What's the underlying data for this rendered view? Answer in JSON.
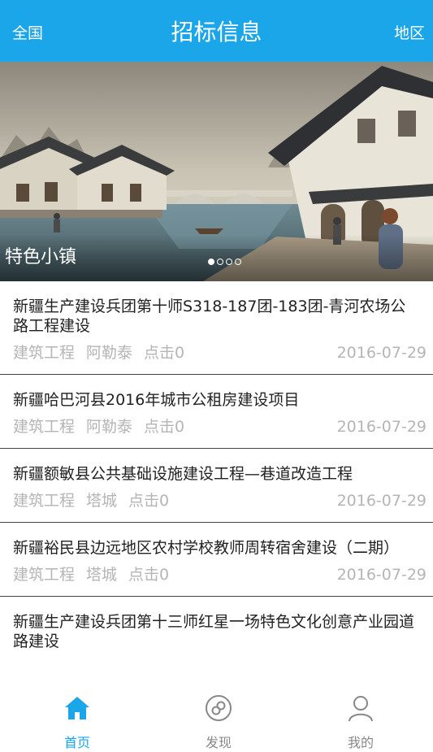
{
  "header": {
    "left": "全国",
    "title": "招标信息",
    "right": "地区"
  },
  "banner": {
    "caption": "特色小镇",
    "dots": 4,
    "active_dot": 0
  },
  "list": [
    {
      "title": "新疆生产建设兵团第十师S318-187团-183团-青河农场公路工程建设",
      "category": "建筑工程",
      "area": "阿勒泰",
      "clicks": "点击0",
      "date": "2016-07-29"
    },
    {
      "title": "新疆哈巴河县2016年城市公租房建设项目",
      "category": "建筑工程",
      "area": "阿勒泰",
      "clicks": "点击0",
      "date": "2016-07-29"
    },
    {
      "title": "新疆额敏县公共基础设施建设工程—巷道改造工程",
      "category": "建筑工程",
      "area": "塔城",
      "clicks": "点击0",
      "date": "2016-07-29"
    },
    {
      "title": "新疆裕民县边远地区农村学校教师周转宿舍建设（二期）",
      "category": "建筑工程",
      "area": "塔城",
      "clicks": "点击0",
      "date": "2016-07-29"
    },
    {
      "title": "新疆生产建设兵团第十三师红星一场特色文化创意产业园道路建设",
      "category": "",
      "area": "",
      "clicks": "",
      "date": ""
    }
  ],
  "tabs": [
    {
      "label": "首页",
      "icon": "home-icon",
      "active": true
    },
    {
      "label": "发现",
      "icon": "discover-icon",
      "active": false
    },
    {
      "label": "我的",
      "icon": "profile-icon",
      "active": false
    }
  ],
  "colors": {
    "accent": "#1aa6e8",
    "meta_text": "#b5b5b5",
    "inactive_tab": "#888888"
  }
}
